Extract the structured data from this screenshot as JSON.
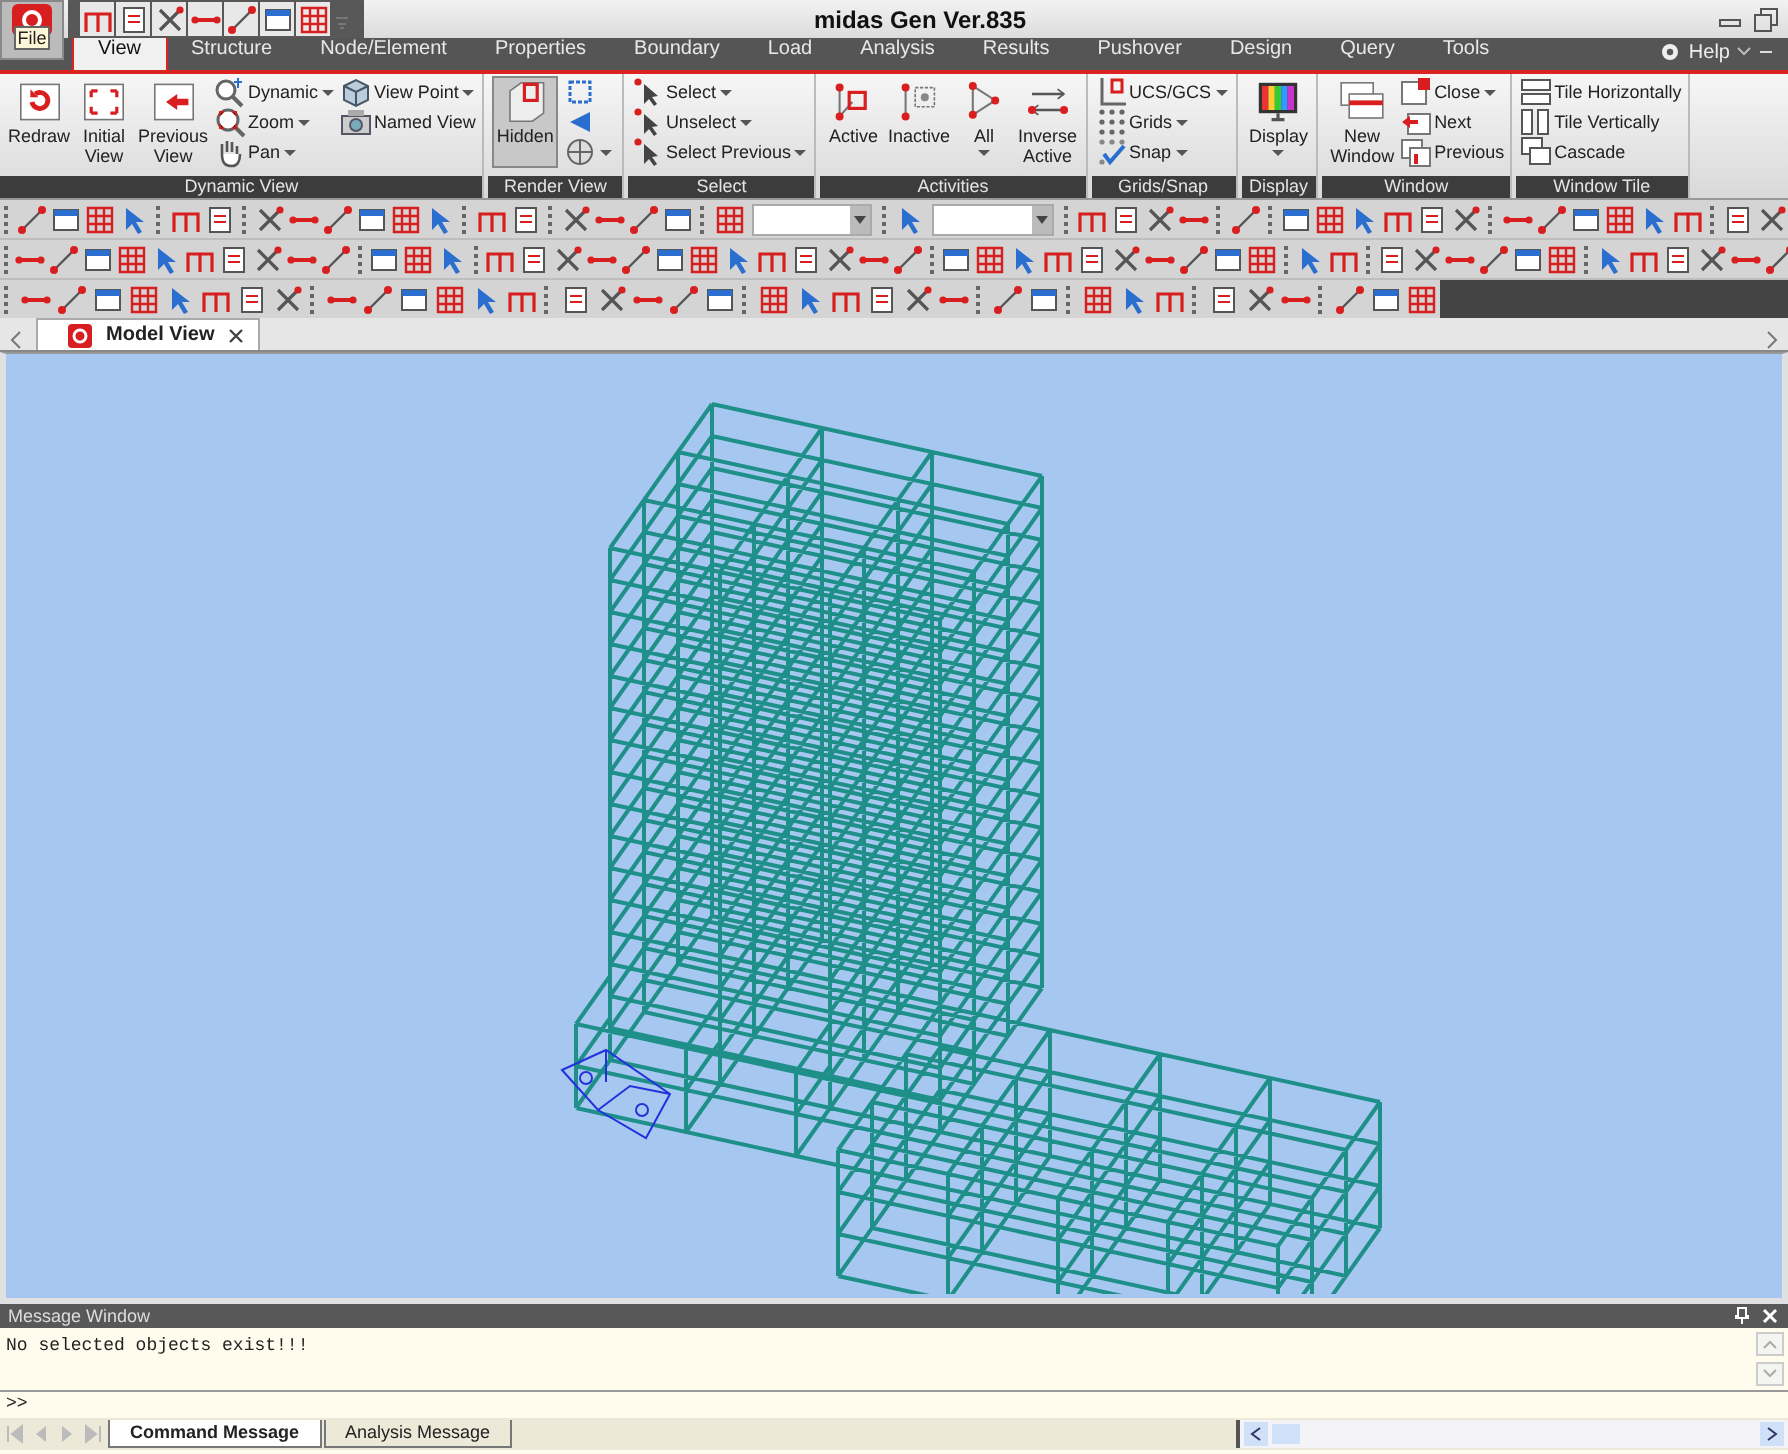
{
  "window": {
    "title": "midas Gen Ver.835"
  },
  "app_button": {
    "label": "File"
  },
  "menu_tabs": [
    {
      "label": "View",
      "selected": true
    },
    {
      "label": "Structure",
      "selected": false
    },
    {
      "label": "Node/Element",
      "selected": false
    },
    {
      "label": "Properties",
      "selected": false
    },
    {
      "label": "Boundary",
      "selected": false
    },
    {
      "label": "Load",
      "selected": false
    },
    {
      "label": "Analysis",
      "selected": false
    },
    {
      "label": "Results",
      "selected": false
    },
    {
      "label": "Pushover",
      "selected": false
    },
    {
      "label": "Design",
      "selected": false
    },
    {
      "label": "Query",
      "selected": false
    },
    {
      "label": "Tools",
      "selected": false
    }
  ],
  "help": {
    "label": "Help"
  },
  "ribbon_groups": [
    {
      "title": "Dynamic View",
      "items": [
        {
          "kind": "large",
          "label": "Redraw",
          "dropdown": false
        },
        {
          "kind": "large",
          "label": "Initial View",
          "dropdown": false
        },
        {
          "kind": "large",
          "label": "Previous View",
          "dropdown": false
        },
        {
          "kind": "small",
          "label": "Dynamic",
          "dropdown": true
        },
        {
          "kind": "small",
          "label": "Zoom",
          "dropdown": true
        },
        {
          "kind": "small",
          "label": "Pan",
          "dropdown": true
        },
        {
          "kind": "small",
          "label": "View Point",
          "dropdown": true
        },
        {
          "kind": "small",
          "label": "Named View",
          "dropdown": false
        }
      ]
    },
    {
      "title": "Render View",
      "items": [
        {
          "kind": "large",
          "label": "Hidden",
          "dropdown": false,
          "pressed": true
        },
        {
          "kind": "icon",
          "dropdown": false
        },
        {
          "kind": "icon",
          "dropdown": false
        },
        {
          "kind": "icon",
          "dropdown": true
        }
      ]
    },
    {
      "title": "Select",
      "items": [
        {
          "kind": "small",
          "label": "Select",
          "dropdown": true
        },
        {
          "kind": "small",
          "label": "Unselect",
          "dropdown": true
        },
        {
          "kind": "small",
          "label": "Select Previous",
          "dropdown": true
        }
      ]
    },
    {
      "title": "Activities",
      "items": [
        {
          "kind": "large",
          "label": "Active",
          "dropdown": false
        },
        {
          "kind": "large",
          "label": "Inactive",
          "dropdown": false
        },
        {
          "kind": "large",
          "label": "All",
          "dropdown": true
        },
        {
          "kind": "large",
          "label": "Inverse Active",
          "dropdown": false
        }
      ]
    },
    {
      "title": "Grids/Snap",
      "items": [
        {
          "kind": "small",
          "label": "UCS/GCS",
          "dropdown": true
        },
        {
          "kind": "small",
          "label": "Grids",
          "dropdown": true
        },
        {
          "kind": "small",
          "label": "Snap",
          "dropdown": true
        }
      ]
    },
    {
      "title": "Display",
      "items": [
        {
          "kind": "large",
          "label": "Display",
          "dropdown": true
        }
      ]
    },
    {
      "title": "Window",
      "items": [
        {
          "kind": "large",
          "label": "New Window",
          "dropdown": false
        },
        {
          "kind": "small",
          "label": "Close",
          "dropdown": true
        },
        {
          "kind": "small",
          "label": "Next",
          "dropdown": false
        },
        {
          "kind": "small",
          "label": "Previous",
          "dropdown": false
        }
      ]
    },
    {
      "title": "Window Tile",
      "items": [
        {
          "kind": "small",
          "label": "Tile Horizontally",
          "dropdown": false
        },
        {
          "kind": "small",
          "label": "Tile Vertically",
          "dropdown": false
        },
        {
          "kind": "small",
          "label": "Cascade",
          "dropdown": false
        }
      ]
    }
  ],
  "document_tabs": [
    {
      "label": "Model View",
      "selected": true
    }
  ],
  "message_window": {
    "title": "Message Window",
    "lines": [
      "No selected objects exist!!!"
    ],
    "prompt": ">>",
    "tabs": [
      {
        "label": "Command Message",
        "selected": true
      },
      {
        "label": "Analysis Message",
        "selected": false
      }
    ]
  }
}
